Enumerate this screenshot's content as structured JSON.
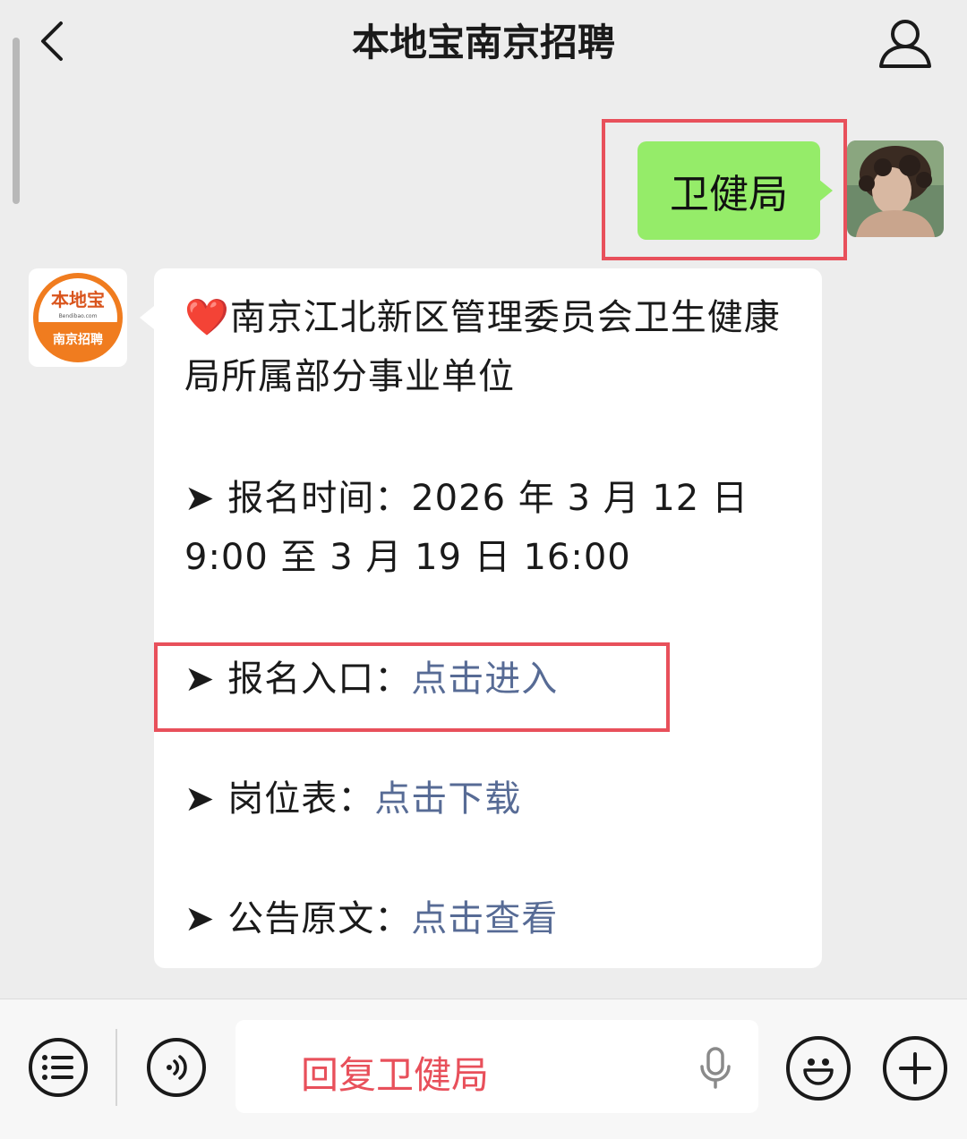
{
  "header": {
    "title": "本地宝南京招聘"
  },
  "chat": {
    "user_message": "卫健局",
    "bot_avatar": {
      "top_text": "本地宝",
      "mid_text": "Bendibao.com",
      "bottom_text": "南京招聘"
    },
    "bot_message": {
      "heart": "❤️",
      "title": "南京江北新区管理委员会卫生健康局所属部分事业单位",
      "lines": [
        {
          "prefix": "➤ 报名时间：2026 年 3 月 12 日 9:00 至 3 月 19 日 16:00",
          "link": ""
        },
        {
          "prefix": "➤ 报名入口：",
          "link": "点击进入"
        },
        {
          "prefix": "➤ 岗位表：",
          "link": "点击下载"
        },
        {
          "prefix": "➤ 公告原文：",
          "link": "点击查看"
        }
      ]
    }
  },
  "input": {
    "value": "回复卫健局"
  },
  "colors": {
    "user_bubble": "#95ec69",
    "link": "#576b95",
    "highlight": "#e8505b",
    "brand_orange": "#f07c1f"
  }
}
